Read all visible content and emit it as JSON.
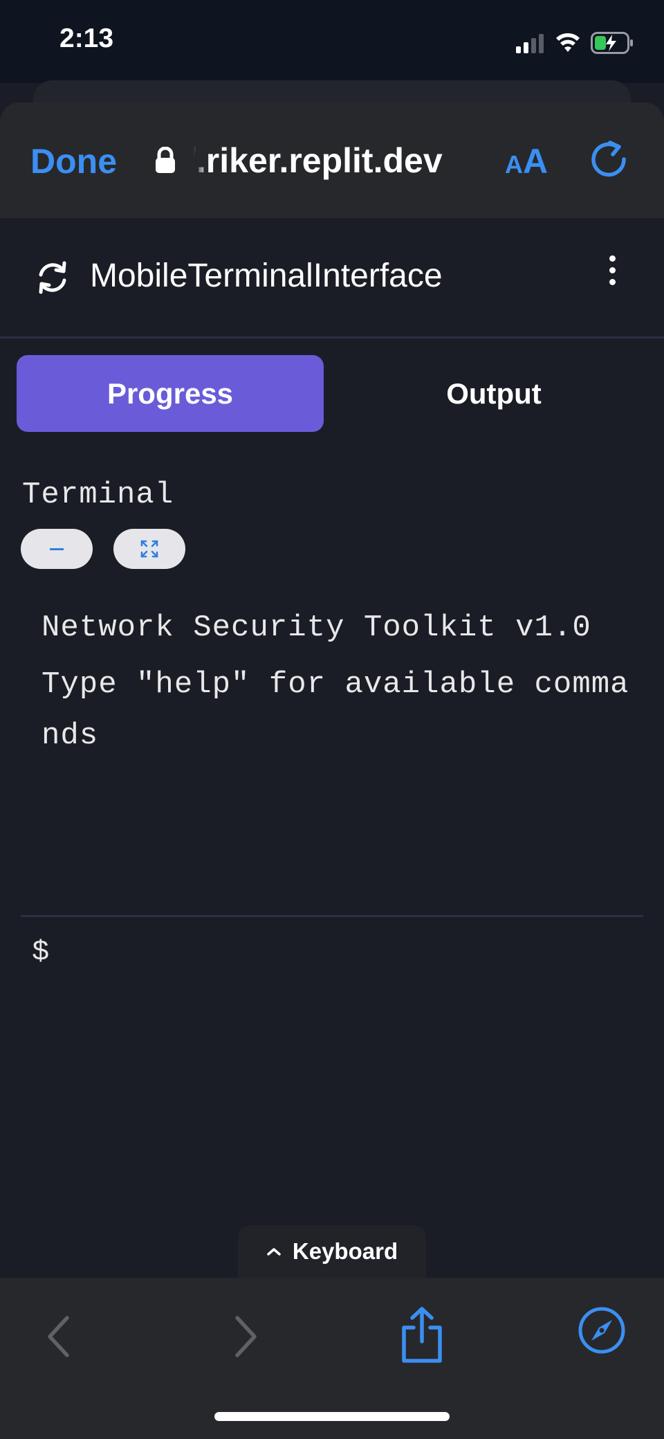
{
  "status_bar": {
    "time": "2:13"
  },
  "browser": {
    "done_label": "Done",
    "url": "/.riker.replit.dev",
    "text_size_small": "A",
    "text_size_large": "A",
    "accent_color": "#3b8ff2"
  },
  "app": {
    "title": "MobileTerminalInterface",
    "tabs": [
      {
        "label": "Progress",
        "active": true
      },
      {
        "label": "Output",
        "active": false
      }
    ],
    "active_tab_color": "#6a5cd8"
  },
  "terminal": {
    "label": "Terminal",
    "minimize_symbol": "–",
    "output_lines": [
      "Network Security Toolkit v1.0",
      "Type \"help\" for available commands"
    ],
    "prompt": "$",
    "input_value": ""
  },
  "keyboard_tab": {
    "label": "Keyboard",
    "chevron": "⌃"
  }
}
